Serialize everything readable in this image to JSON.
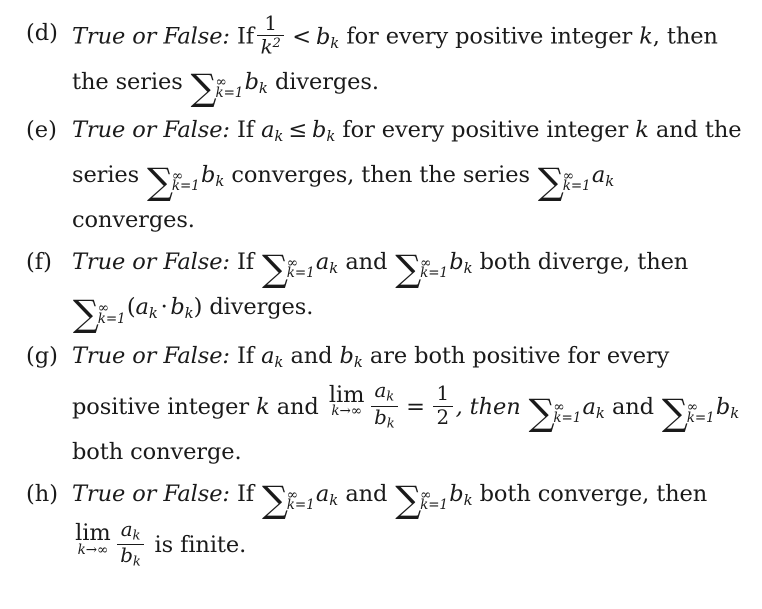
{
  "document": {
    "type": "math-exercise-list",
    "background_color": "#ffffff",
    "text_color": "#1a1a1a",
    "prompt_phrase": "True or False:"
  },
  "symbols": {
    "sigma": "∑",
    "infinity": "∞",
    "less_than": "<",
    "less_or_equal": "≤",
    "equals": "=",
    "arrow_right": "→",
    "center_dot": "·",
    "lim": "lim",
    "sum_lower": "k=1",
    "lim_sub_var": "k",
    "index_k": "k",
    "one": "1",
    "two": "2",
    "var_a": "a",
    "var_b": "b"
  },
  "exercises": [
    {
      "label": "(d)",
      "id": "exercise-d",
      "text_segments": {
        "s1": "If",
        "s2": "for every positive integer",
        "s3": ",",
        "s4": "then the series",
        "s5": "diverges."
      }
    },
    {
      "label": "(e)",
      "id": "exercise-e",
      "text_segments": {
        "s1": "If",
        "s2": "for every positive integer",
        "s3": "and the series",
        "s4": "converges, then the series",
        "s5": "converges."
      }
    },
    {
      "label": "(f)",
      "id": "exercise-f",
      "text_segments": {
        "s1": "If",
        "s2": "and",
        "s3": "both diverge, then",
        "s4": "diverges."
      }
    },
    {
      "label": "(g)",
      "id": "exercise-g",
      "text_segments": {
        "s1": "If",
        "s2": "and",
        "s3": "are both positive for every positive integer",
        "s4": "and",
        "s5": ", then",
        "s6": "and",
        "s7": "both converge."
      }
    },
    {
      "label": "(h)",
      "id": "exercise-h",
      "text_segments": {
        "s1": "If",
        "s2": "and",
        "s3": "both converge, then",
        "s4": "is finite."
      }
    }
  ]
}
